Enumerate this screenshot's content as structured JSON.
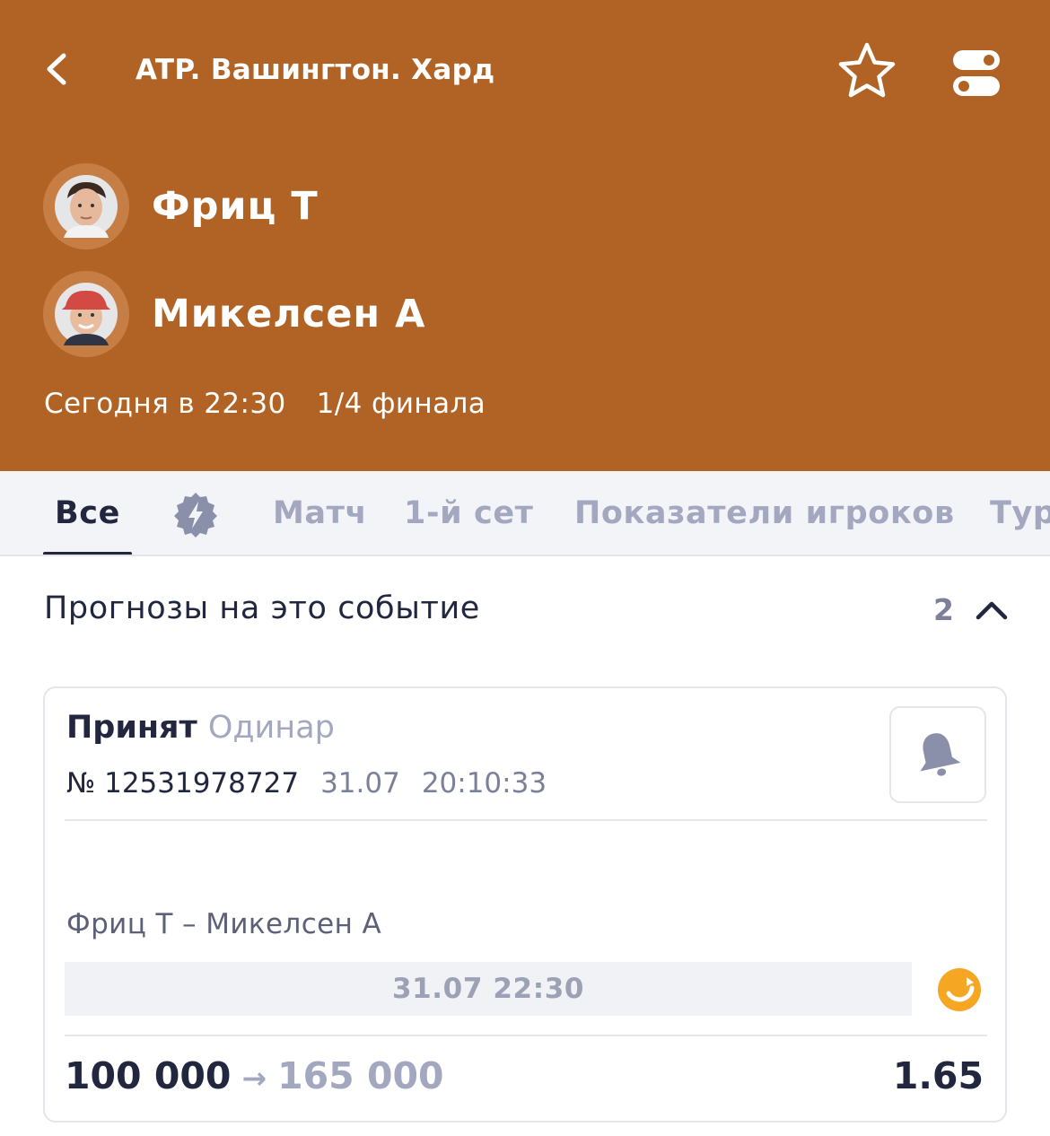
{
  "header": {
    "title": "ATP. Вашингтон. Хард",
    "player1": "Фриц Т",
    "player2": "Микелсен А",
    "time": "Сегодня в 22:30",
    "round": "1/4 финала",
    "background_color": "#b06324"
  },
  "tabs": [
    {
      "label": "Все",
      "active": true
    },
    {
      "label": "Матч"
    },
    {
      "label": "1-й сет"
    },
    {
      "label": "Показатели игроков"
    },
    {
      "label": "Тур"
    }
  ],
  "predictions": {
    "title": "Прогнозы на это событие",
    "count": "2"
  },
  "bet": {
    "status": "Принят",
    "type": "Одинар",
    "number": "№ 12531978727",
    "date": "31.07",
    "time": "20:10:33",
    "event": "Фриц Т – Микелсен А",
    "event_datetime": "31.07 22:30",
    "stake": "100 000",
    "arrow": "→",
    "payout": "165 000",
    "coefficient": "1.65"
  }
}
